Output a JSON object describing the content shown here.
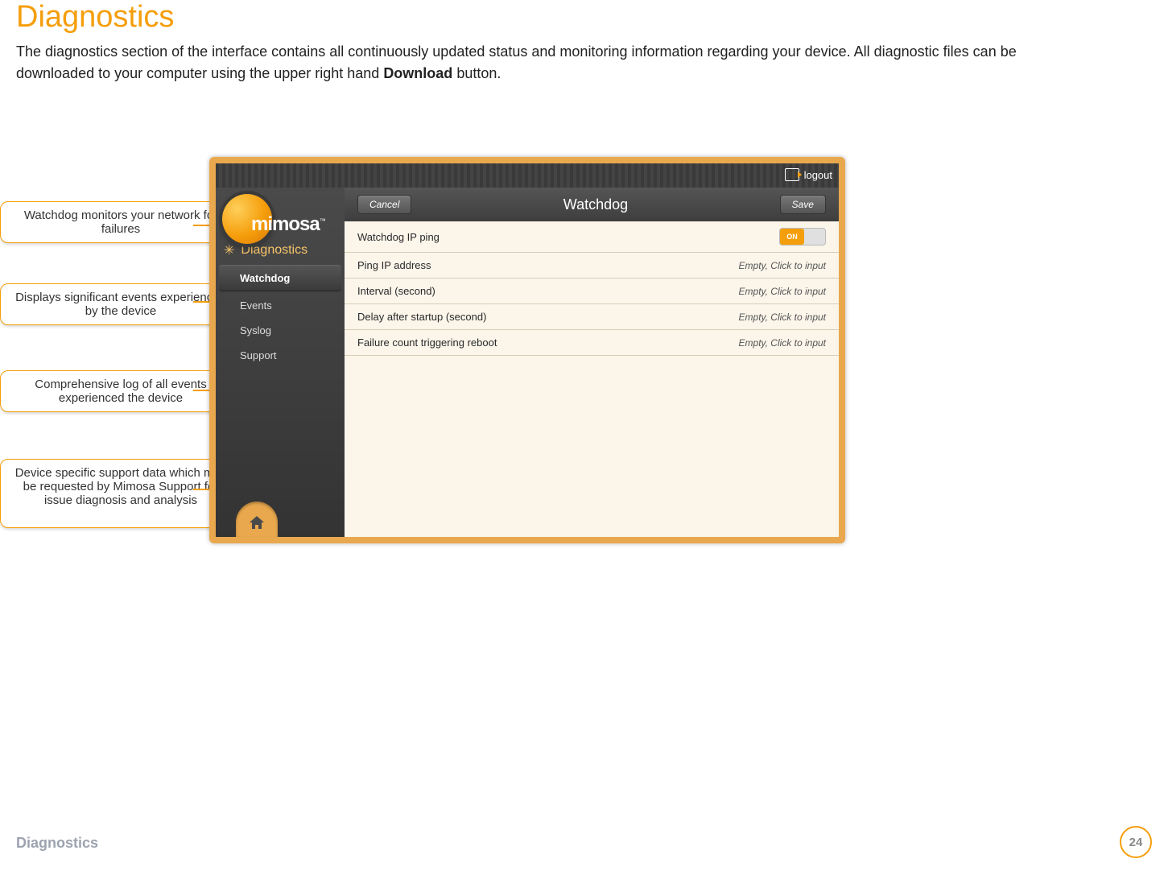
{
  "page": {
    "title": "Diagnostics",
    "intro_before": "The diagnostics section of the interface contains all continuously updated status and monitoring information regarding your device. All diagnostic files can be downloaded to your computer using the upper right hand ",
    "intro_bold": "Download",
    "intro_after": " button.",
    "footer_label": "Diagnostics",
    "page_number": "24"
  },
  "callouts": {
    "c1": "Watchdog monitors your network for failures",
    "c2": "Displays significant events experienced by the device",
    "c3": "Comprehensive log of all events experienced the device",
    "c4": "Device specific support data which may be requested by Mimosa Support for issue diagnosis and analysis"
  },
  "app": {
    "brand": "mimosa",
    "brand_tm": "™",
    "logout": "logout",
    "section": "Diagnostics",
    "sidebar": {
      "watchdog": "Watchdog",
      "events": "Events",
      "syslog": "Syslog",
      "support": "Support"
    },
    "panel": {
      "title": "Watchdog",
      "cancel": "Cancel",
      "save": "Save",
      "toggle_on": "ON",
      "rows": {
        "r1": {
          "label": "Watchdog IP ping"
        },
        "r2": {
          "label": "Ping IP address",
          "value": "Empty, Click to input"
        },
        "r3": {
          "label": "Interval (second)",
          "value": "Empty, Click to input"
        },
        "r4": {
          "label": "Delay after startup (second)",
          "value": "Empty, Click to input"
        },
        "r5": {
          "label": "Failure count triggering reboot",
          "value": "Empty, Click to input"
        }
      }
    }
  }
}
